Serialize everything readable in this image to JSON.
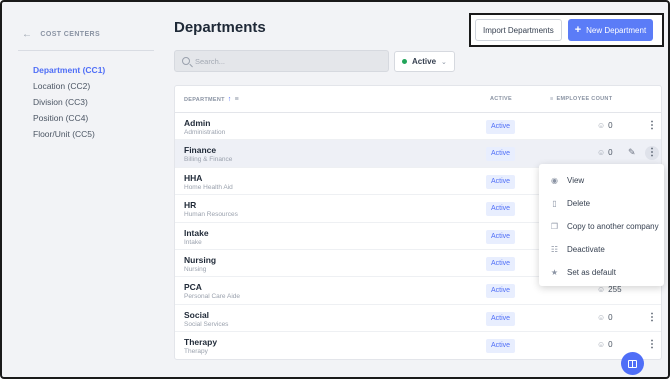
{
  "sidebar": {
    "heading": "COST CENTERS",
    "items": [
      {
        "label": "Department (CC1)",
        "active": true
      },
      {
        "label": "Location (CC2)"
      },
      {
        "label": "Division (CC3)"
      },
      {
        "label": "Position (CC4)"
      },
      {
        "label": "Floor/Unit (CC5)"
      }
    ]
  },
  "header": {
    "title": "Departments",
    "import_label": "Import Departments",
    "new_label": "New Department"
  },
  "search": {
    "placeholder": "Search..."
  },
  "filter": {
    "status": "Active"
  },
  "table": {
    "columns": {
      "department": "DEPARTMENT",
      "active": "ACTIVE",
      "employee_count": "EMPLOYEE COUNT"
    },
    "rows": [
      {
        "name": "Admin",
        "sub": "Administration",
        "status": "Active",
        "count": "0"
      },
      {
        "name": "Finance",
        "sub": "Billing & Finance",
        "status": "Active",
        "count": "0"
      },
      {
        "name": "HHA",
        "sub": "Home Health Aid",
        "status": "Active",
        "count": ""
      },
      {
        "name": "HR",
        "sub": "Human Resources",
        "status": "Active",
        "count": ""
      },
      {
        "name": "Intake",
        "sub": "Intake",
        "status": "Active",
        "count": ""
      },
      {
        "name": "Nursing",
        "sub": "Nursing",
        "status": "Active",
        "count": ""
      },
      {
        "name": "PCA",
        "sub": "Personal Care Aide",
        "status": "Active",
        "count": "255"
      },
      {
        "name": "Social",
        "sub": "Social Services",
        "status": "Active",
        "count": "0"
      },
      {
        "name": "Therapy",
        "sub": "Therapy",
        "status": "Active",
        "count": "0"
      }
    ]
  },
  "menu": {
    "items": [
      {
        "label": "View",
        "icon": "eye-icon"
      },
      {
        "label": "Delete",
        "icon": "trash-icon"
      },
      {
        "label": "Copy to another company",
        "icon": "copy-icon"
      },
      {
        "label": "Deactivate",
        "icon": "deactivate-icon"
      },
      {
        "label": "Set as default",
        "icon": "star-icon"
      }
    ]
  },
  "colors": {
    "accent": "#4f6ef7",
    "active_dot": "#22a55a"
  }
}
